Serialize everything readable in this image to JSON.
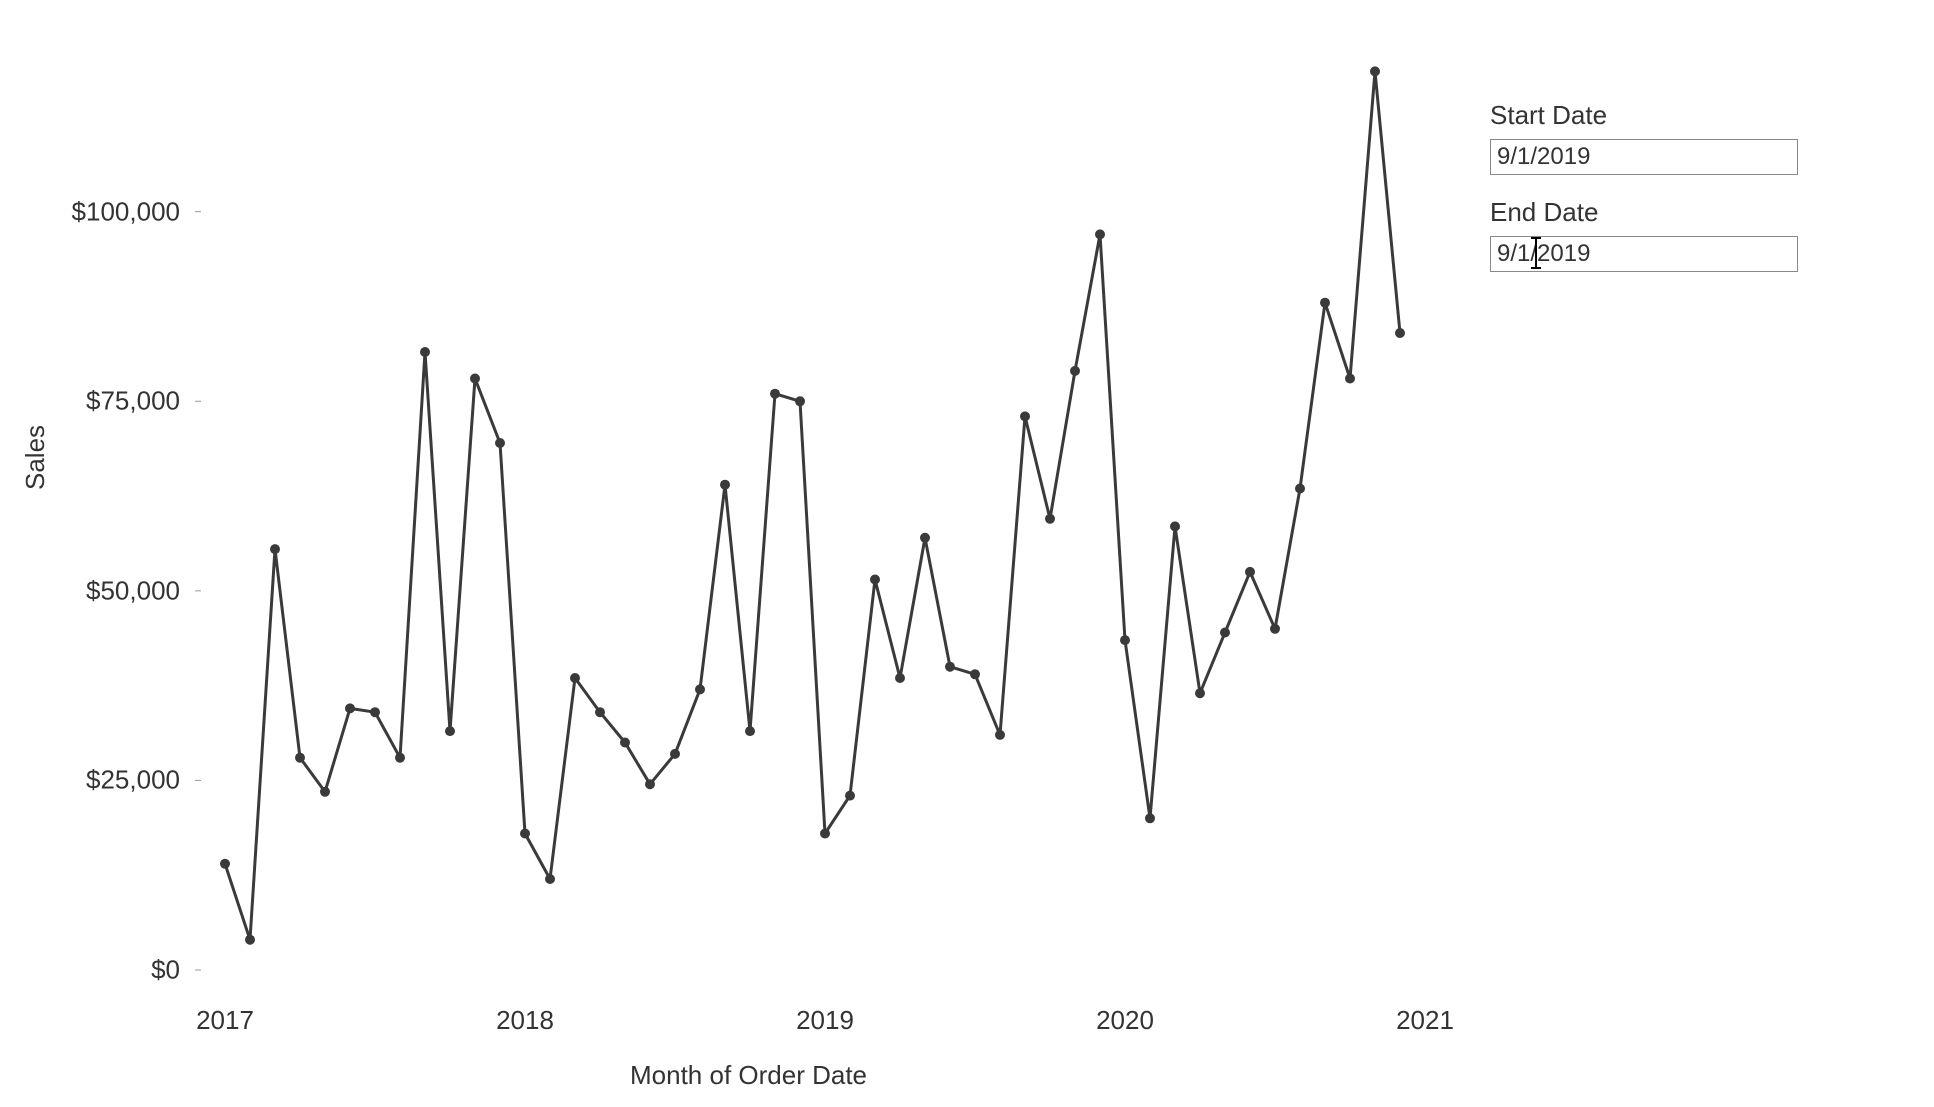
{
  "controls": {
    "start_date_label": "Start Date",
    "start_date_value": "9/1/2019",
    "end_date_label": "End Date",
    "end_date_value": "9/1/2019"
  },
  "chart_data": {
    "type": "line",
    "xlabel": "Month of Order Date",
    "ylabel": "Sales",
    "ylim": [
      0,
      120000
    ],
    "x_ticks": [
      "2017",
      "2018",
      "2019",
      "2020",
      "2021"
    ],
    "y_ticks": [
      "$0",
      "$25,000",
      "$50,000",
      "$75,000",
      "$100,000"
    ],
    "y_tick_values": [
      0,
      25000,
      50000,
      75000,
      100000
    ],
    "series": [
      {
        "name": "Sales",
        "x": [
          "2017-01",
          "2017-02",
          "2017-03",
          "2017-04",
          "2017-05",
          "2017-06",
          "2017-07",
          "2017-08",
          "2017-09",
          "2017-10",
          "2017-11",
          "2017-12",
          "2018-01",
          "2018-02",
          "2018-03",
          "2018-04",
          "2018-05",
          "2018-06",
          "2018-07",
          "2018-08",
          "2018-09",
          "2018-10",
          "2018-11",
          "2018-12",
          "2019-01",
          "2019-02",
          "2019-03",
          "2019-04",
          "2019-05",
          "2019-06",
          "2019-07",
          "2019-08",
          "2019-09",
          "2019-10",
          "2019-11",
          "2019-12",
          "2020-01",
          "2020-02",
          "2020-03",
          "2020-04",
          "2020-05",
          "2020-06",
          "2020-07",
          "2020-08",
          "2020-09",
          "2020-10",
          "2020-11",
          "2020-12"
        ],
        "values": [
          14000,
          4000,
          55500,
          28000,
          23500,
          34500,
          34000,
          28000,
          81500,
          31500,
          78000,
          69500,
          18000,
          12000,
          38500,
          34000,
          30000,
          24500,
          28500,
          37000,
          64000,
          31500,
          76000,
          75000,
          18000,
          23000,
          51500,
          38500,
          57000,
          40000,
          39000,
          31000,
          73000,
          59500,
          79000,
          97000,
          43500,
          20000,
          58500,
          36500,
          44500,
          52500,
          45000,
          63500,
          88000,
          78000,
          118500,
          84000
        ]
      }
    ]
  }
}
